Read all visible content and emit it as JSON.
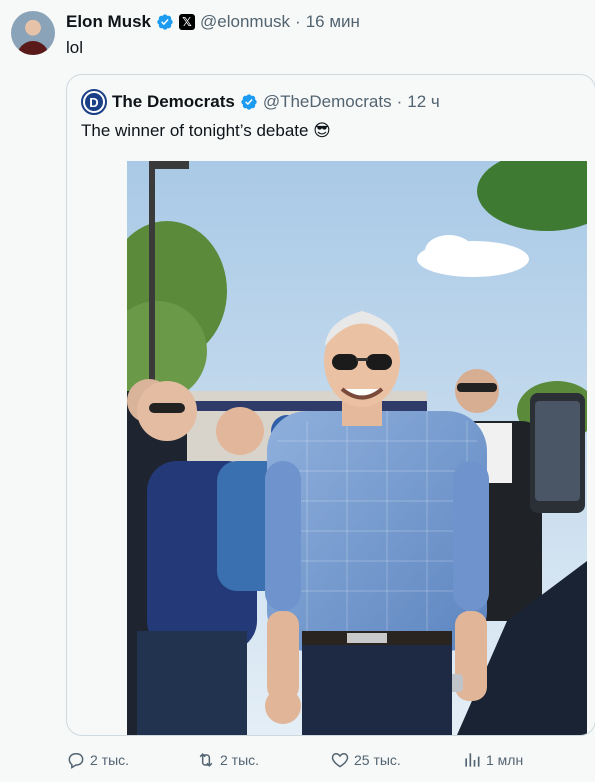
{
  "tweet": {
    "author_name": "Elon Musk",
    "handle": "@elonmusk",
    "separator": "·",
    "time": "16 мин",
    "text": "lol"
  },
  "quote": {
    "author_name": "The Democrats",
    "logo_letter": "D",
    "handle": "@TheDemocrats",
    "separator": "·",
    "time": "12 ч",
    "text": "The winner of tonight’s debate 😎"
  },
  "actions": {
    "replies": "2 тыс.",
    "retweets": "2 тыс.",
    "likes": "25 тыс.",
    "views": "1 млн"
  },
  "icons": {
    "reply": "reply-icon",
    "retweet": "retweet-icon",
    "like": "heart-icon",
    "views": "views-icon",
    "verified": "verified-badge-icon",
    "x_affiliation": "x-logo-icon"
  },
  "colors": {
    "verified_blue": "#1d9bf0",
    "muted_text": "#536471",
    "background": "#f7f9f9"
  }
}
